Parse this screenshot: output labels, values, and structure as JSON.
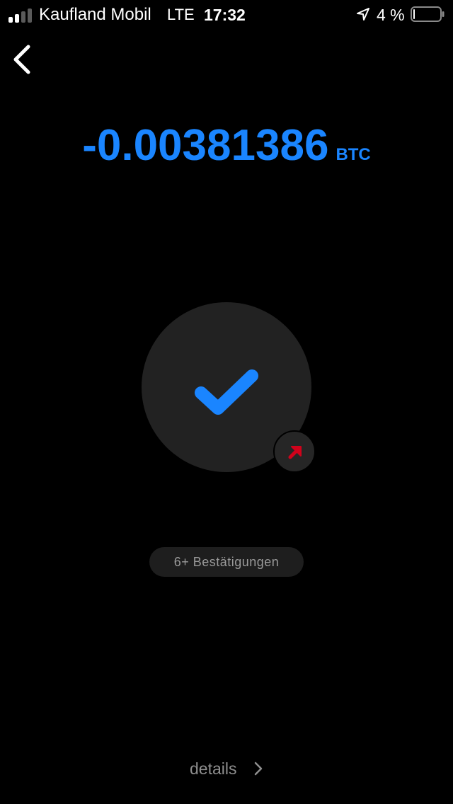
{
  "status_bar": {
    "carrier": "Kaufland Mobil",
    "network": "LTE",
    "time": "17:32",
    "battery_percent": "4 %",
    "battery_level": 0.04,
    "signal_bars_filled": 2,
    "signal_bars_total": 4,
    "icons": [
      "signal-icon",
      "location-arrow-icon",
      "battery-icon"
    ]
  },
  "navigation": {
    "back_icon": "chevron-left-icon"
  },
  "transaction": {
    "amount": "-0.00381386",
    "unit": "BTC",
    "status_icon": "checkmark-icon",
    "direction_icon": "outgoing-arrow-icon",
    "confirmations": "6+ Bestätigungen"
  },
  "footer": {
    "details_label": "details",
    "details_icon": "chevron-right-icon"
  },
  "colors": {
    "background": "#000000",
    "accent_blue": "#1a85ff",
    "circle": "#222222",
    "badge": "#262626",
    "outgoing_red": "#d0021b",
    "pill_bg": "#1e1e1e",
    "pill_text": "#9a9a9a",
    "details_text": "#8e8e8e",
    "text_white": "#ffffff"
  }
}
